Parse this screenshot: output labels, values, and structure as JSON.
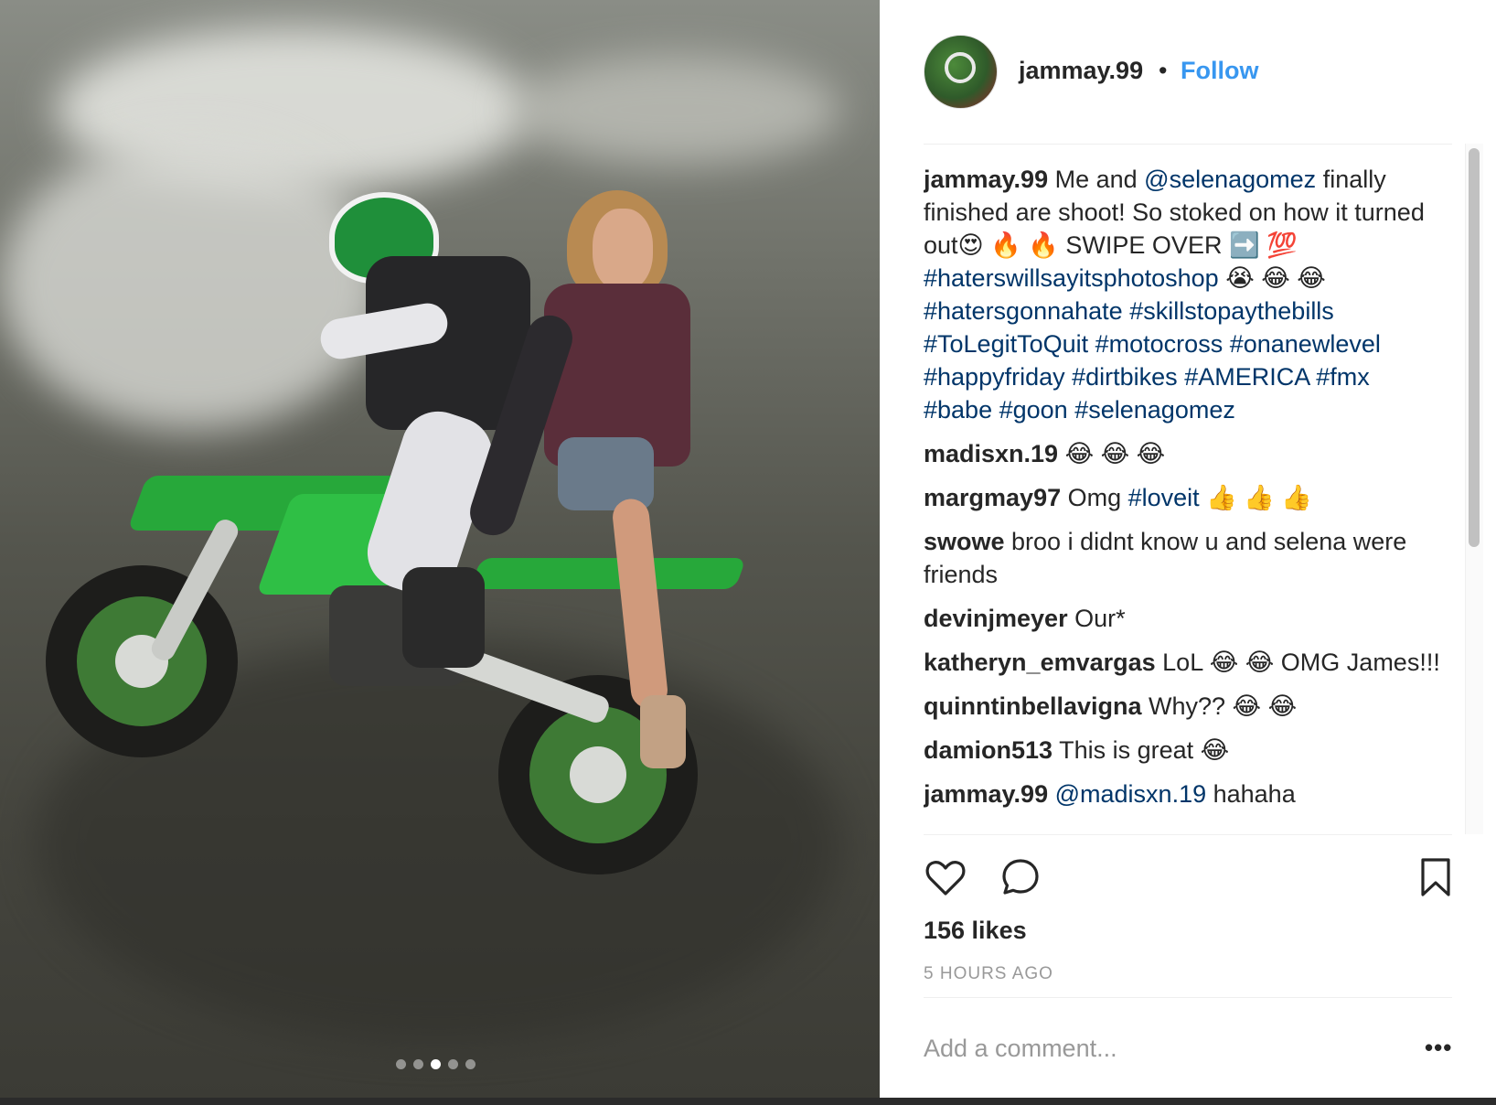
{
  "post": {
    "author": "jammay.99",
    "separator": "•",
    "follow_label": "Follow",
    "carousel": {
      "count": 5,
      "active_index": 2
    }
  },
  "caption": {
    "username": "jammay.99",
    "parts": [
      {
        "text": " Me and ",
        "type": "text"
      },
      {
        "text": "@selenagomez",
        "type": "tag"
      },
      {
        "text": " finally finished are shoot! So stoked on how it turned out😍 🔥 🔥 SWIPE OVER ➡️ 💯 ",
        "type": "text"
      },
      {
        "text": "#haterswillsayitsphotoshop",
        "type": "tag"
      },
      {
        "text": " 😭 😂 😂 ",
        "type": "text"
      },
      {
        "text": "#hatersgonnahate",
        "type": "tag"
      },
      {
        "text": " ",
        "type": "text"
      },
      {
        "text": "#skillstopaythebills",
        "type": "tag"
      },
      {
        "text": " ",
        "type": "text"
      },
      {
        "text": "#ToLegitToQuit",
        "type": "tag"
      },
      {
        "text": " ",
        "type": "text"
      },
      {
        "text": "#motocross",
        "type": "tag"
      },
      {
        "text": " ",
        "type": "text"
      },
      {
        "text": "#onanewlevel",
        "type": "tag"
      },
      {
        "text": " ",
        "type": "text"
      },
      {
        "text": "#happyfriday",
        "type": "tag"
      },
      {
        "text": " ",
        "type": "text"
      },
      {
        "text": "#dirtbikes",
        "type": "tag"
      },
      {
        "text": " ",
        "type": "text"
      },
      {
        "text": "#AMERICA",
        "type": "tag"
      },
      {
        "text": " ",
        "type": "text"
      },
      {
        "text": "#fmx",
        "type": "tag"
      },
      {
        "text": " ",
        "type": "text"
      },
      {
        "text": "#babe",
        "type": "tag"
      },
      {
        "text": " ",
        "type": "text"
      },
      {
        "text": "#goon",
        "type": "tag"
      },
      {
        "text": " ",
        "type": "text"
      },
      {
        "text": "#selenagomez",
        "type": "tag"
      }
    ]
  },
  "comments": [
    {
      "username": "madisxn.19",
      "parts": [
        {
          "text": " 😂 😂 😂",
          "type": "text"
        }
      ]
    },
    {
      "username": "margmay97",
      "parts": [
        {
          "text": " Omg ",
          "type": "text"
        },
        {
          "text": "#loveit",
          "type": "tag"
        },
        {
          "text": " 👍 👍 👍",
          "type": "text"
        }
      ]
    },
    {
      "username": "swowe",
      "parts": [
        {
          "text": " broo i didnt know u and selena were friends",
          "type": "text"
        }
      ]
    },
    {
      "username": "devinjmeyer",
      "parts": [
        {
          "text": " Our*",
          "type": "text"
        }
      ]
    },
    {
      "username": "katheryn_emvargas",
      "parts": [
        {
          "text": " LoL 😂 😂  OMG James!!!",
          "type": "text"
        }
      ]
    },
    {
      "username": "quinntinbellavigna",
      "parts": [
        {
          "text": " Why?? 😂 😂",
          "type": "text"
        }
      ]
    },
    {
      "username": "damion513",
      "parts": [
        {
          "text": " This is great 😂",
          "type": "text"
        }
      ]
    },
    {
      "username": "jammay.99",
      "parts": [
        {
          "text": " ",
          "type": "text"
        },
        {
          "text": "@madisxn.19",
          "type": "tag"
        },
        {
          "text": " hahaha",
          "type": "text"
        }
      ]
    }
  ],
  "engagement": {
    "likes": "156 likes",
    "timestamp": "5 HOURS AGO"
  },
  "composer": {
    "placeholder": "Add a comment...",
    "more_label": "•••"
  },
  "icons": {
    "like": "heart-icon",
    "comment": "comment-bubble-icon",
    "save": "bookmark-icon"
  },
  "colors": {
    "link": "#3897f0",
    "tag": "#003569",
    "muted": "#999999",
    "text": "#262626"
  }
}
